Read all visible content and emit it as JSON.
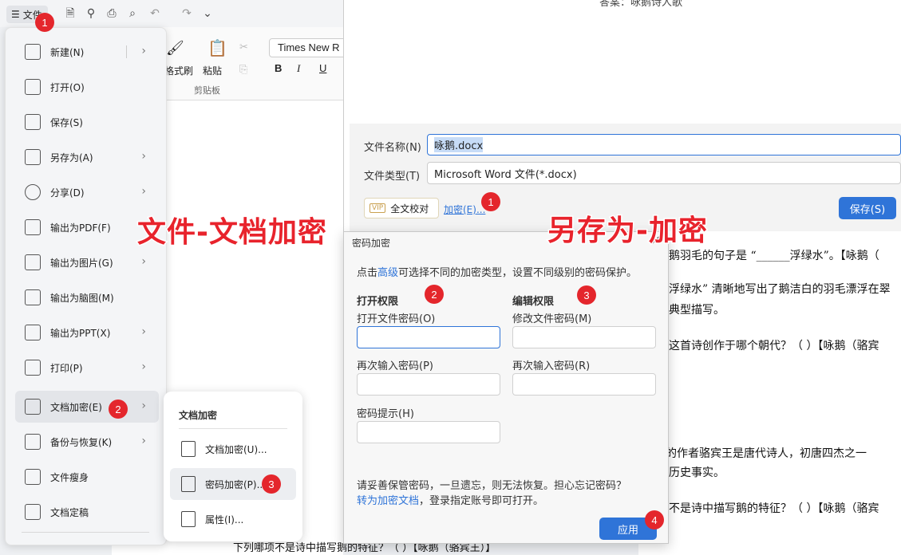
{
  "topbar": {
    "file_label": "文件"
  },
  "ribbon": {
    "format_brush": "格式刷",
    "paste": "粘贴",
    "clipboard": "剪贴板",
    "font": "Times New R",
    "bold": "B",
    "italic": "I",
    "underline": "U"
  },
  "doc": {
    "top_fragment": "答案：咏鹅诗人歌",
    "lines": [
      "鹅羽毛的句子是 “______浮绿水”。【咏鹅（",
      "浮绿水” 清晰地写出了鹅洁白的羽毛漂浮在翠",
      "典型描写。",
      "这首诗创作于哪个朝代？（ ）【咏鹅（骆宾",
      "》的作者骆宾王是唐代诗人，初唐四杰之一",
      "历史事实。",
      "不是诗中描写鹅的特征？（ ）【咏鹅（骆宾"
    ],
    "bottom_line": "下列哪项不是诗中描写鹅的特征？（ ）【咏鹅（骆宾王）】"
  },
  "file_menu": {
    "items": [
      {
        "label": "新建(N)",
        "arrow": true
      },
      {
        "label": "打开(O)",
        "arrow": false
      },
      {
        "label": "保存(S)",
        "arrow": false
      },
      {
        "label": "另存为(A)",
        "arrow": true
      },
      {
        "label": "分享(D)",
        "arrow": true
      },
      {
        "label": "输出为PDF(F)",
        "arrow": false
      },
      {
        "label": "输出为图片(G)",
        "arrow": true
      },
      {
        "label": "输出为脑图(M)",
        "arrow": false
      },
      {
        "label": "输出为PPT(X)",
        "arrow": true
      },
      {
        "label": "打印(P)",
        "arrow": true
      },
      {
        "label": "文档加密(E)",
        "arrow": true
      },
      {
        "label": "备份与恢复(K)",
        "arrow": true
      },
      {
        "label": "文件瘦身",
        "arrow": false
      },
      {
        "label": "文档定稿",
        "arrow": false
      }
    ]
  },
  "submenu": {
    "title": "文档加密",
    "items": [
      "文档加密(U)...",
      "密码加密(P)...",
      "属性(I)..."
    ]
  },
  "save_dialog": {
    "filename_label": "文件名称(N)",
    "filename_value": "咏鹅.docx",
    "filetype_label": "文件类型(T)",
    "filetype_value": "Microsoft Word 文件(*.docx)",
    "vip_badge": "VIP",
    "proofread": "全文校对",
    "encrypt_link": "加密(E)...",
    "save_button": "保存(S)"
  },
  "pwd_dialog": {
    "title": "密码加密",
    "close": "×",
    "intro_pre": "点击",
    "intro_link": "高级",
    "intro_post": "可选择不同的加密类型，设置不同级别的密码保护。",
    "open_section": "打开权限",
    "edit_section": "编辑权限",
    "open_pwd": "打开文件密码(O)",
    "open_repeat": "再次输入密码(P)",
    "hint": "密码提示(H)",
    "edit_pwd": "修改文件密码(M)",
    "edit_repeat": "再次输入密码(R)",
    "warning": "请妥善保管密码，一旦遗忘，则无法恢复。担心忘记密码？",
    "convert_link": "转为加密文档",
    "convert_post": "，登录指定账号即可打开。",
    "apply": "应用"
  },
  "annotations": {
    "left": "文件-文档加密",
    "right": "另存为-加密",
    "badges": [
      "1",
      "2",
      "3",
      "1",
      "2",
      "3",
      "4"
    ]
  },
  "colors": {
    "accent": "#2f74d8",
    "badge": "#e4262c"
  }
}
